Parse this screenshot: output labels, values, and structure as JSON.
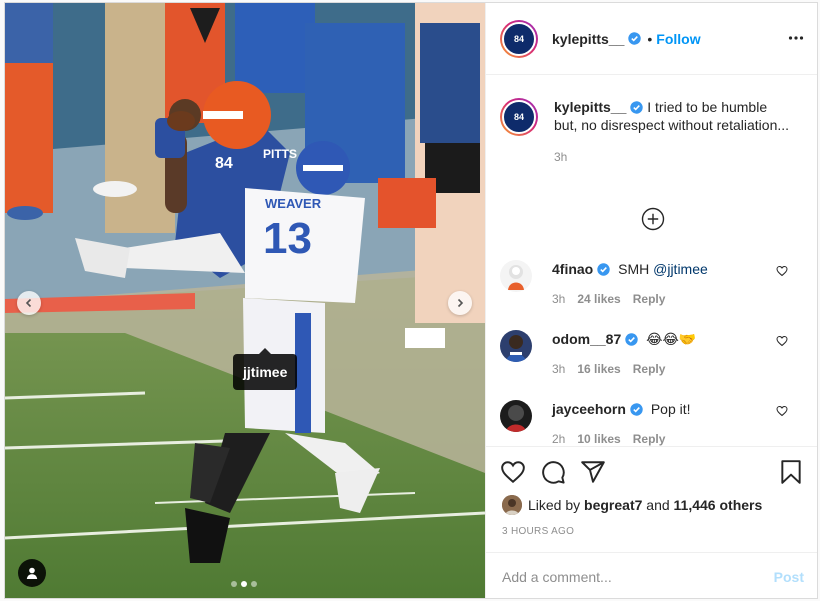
{
  "post": {
    "author": {
      "username": "kylepitts__",
      "avatar_number": "84",
      "verified": true,
      "follow_label": "Follow",
      "separator": "•"
    },
    "media": {
      "tag_label": "jjtimee",
      "jersey_back_name": "WEAVER",
      "jersey_back_number": "13",
      "jersey_front_name": "PITTS",
      "jersey_front_number": "84",
      "slides": 3,
      "active_slide": 2
    },
    "caption": {
      "username": "kylepitts__",
      "text": "I tried to be humble but, no disrespect without retaliation...",
      "time": "3h"
    },
    "comments": [
      {
        "username": "4finao",
        "text": "SMH ",
        "mention": "@jjtimee",
        "time": "3h",
        "likes": "24 likes",
        "reply": "Reply"
      },
      {
        "username": "odom__87",
        "text": "😂😂🤝",
        "mention": "",
        "time": "3h",
        "likes": "16 likes",
        "reply": "Reply"
      },
      {
        "username": "jayceehorn",
        "text": "Pop it!",
        "mention": "",
        "time": "2h",
        "likes": "10 likes",
        "reply": "Reply"
      }
    ],
    "likes": {
      "prefix": "Liked by ",
      "user": "begreat7",
      "middle": " and ",
      "others": "11,446 others"
    },
    "timestamp": "3 HOURS AGO",
    "add_comment": {
      "placeholder": "Add a comment...",
      "post_label": "Post"
    }
  },
  "icons": [
    "more-icon",
    "heart-icon",
    "comment-icon",
    "share-icon",
    "bookmark-icon",
    "load-more-icon",
    "chevron-left-icon",
    "chevron-right-icon",
    "user-tag-icon",
    "verified-icon"
  ],
  "colors": {
    "link": "#0095f6",
    "muted": "#8e8e8e",
    "text": "#262626",
    "post_disabled": "#b2dffc"
  }
}
